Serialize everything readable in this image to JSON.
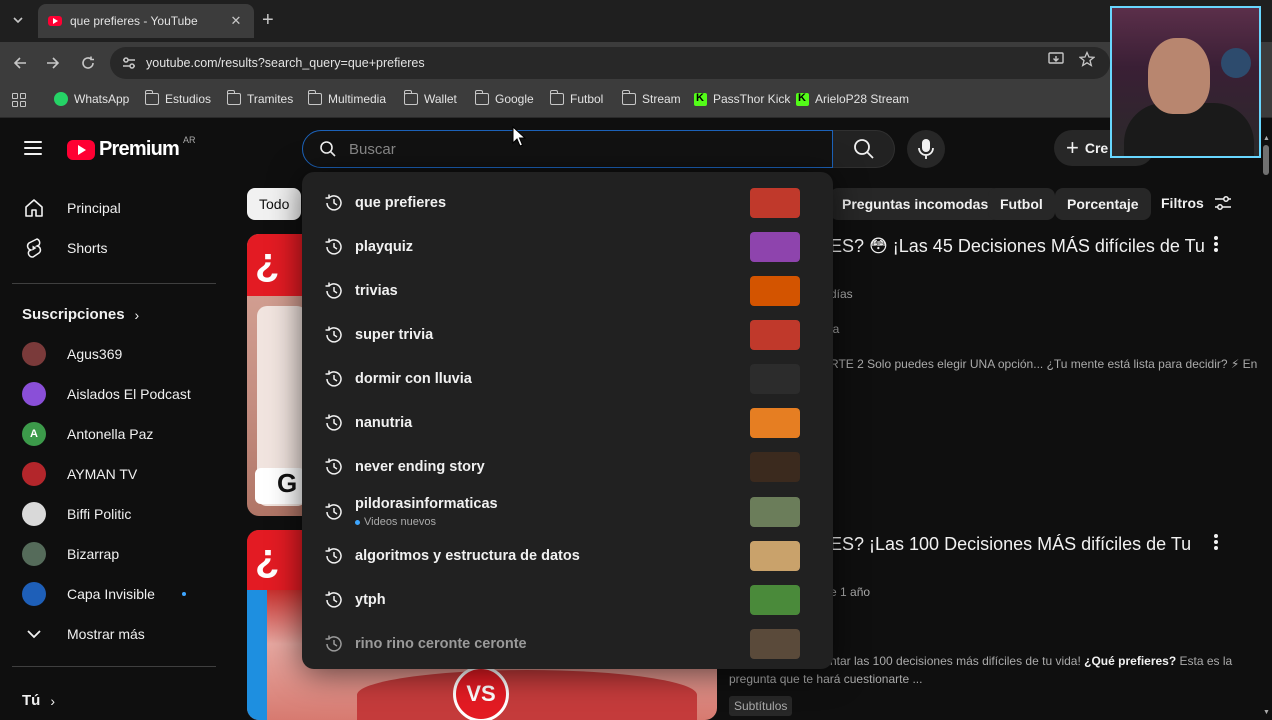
{
  "browser": {
    "tab_title": "que prefieres - YouTube",
    "url": "youtube.com/results?search_query=que+prefieres",
    "bookmarks": [
      "WhatsApp",
      "Estudios",
      "Tramites",
      "Multimedia",
      "Wallet",
      "Google",
      "Futbol",
      "Stream",
      "PassThor Kick",
      "ArieloP28 Stream"
    ]
  },
  "header": {
    "logo_text": "Premium",
    "country_code": "AR",
    "search_placeholder": "Buscar",
    "create_label": "Cre"
  },
  "sidebar": {
    "main": [
      {
        "label": "Principal",
        "icon": "home-icon"
      },
      {
        "label": "Shorts",
        "icon": "shorts-icon"
      }
    ],
    "subscriptions_heading": "Suscripciones",
    "subscriptions": [
      {
        "label": "Agus369",
        "color": "#7a3a3a",
        "initial": ""
      },
      {
        "label": "Aislados El Podcast",
        "color": "#8a4fd8",
        "initial": ""
      },
      {
        "label": "Antonella Paz",
        "color": "#3c9a4a",
        "initial": "A"
      },
      {
        "label": "AYMAN TV",
        "color": "#b3262b",
        "initial": ""
      },
      {
        "label": "Biffi Politic",
        "color": "#d9d9d9",
        "initial": ""
      },
      {
        "label": "Bizarrap",
        "color": "#556b5a",
        "initial": ""
      },
      {
        "label": "Capa Invisible",
        "color": "#1e5fb8",
        "initial": ""
      }
    ],
    "show_more": "Mostrar más",
    "you_heading": "Tú"
  },
  "chips": [
    "Todo",
    "Preguntas incomodas",
    "Futbol",
    "Porcentaje"
  ],
  "filters_label": "Filtros",
  "videos": [
    {
      "title": "ES? 😳 ¡Las 45 Decisiones MÁS difíciles de Tu",
      "meta": "días",
      "channel_frag": "ia",
      "desc": "RTE 2 Solo puedes elegir UNA opción... ¿Tu mente está lista para decidir? ⚡ En"
    },
    {
      "title": "ES? ¡Las 100 Decisiones MÁS difíciles de Tu",
      "meta": "e 1 año",
      "desc1_a": "ntar las 100 decisiones más difíciles de tu vida! ",
      "desc1_b": "¿Qué prefieres?",
      "desc1_c": " Esta es la",
      "desc2": "pregunta que te hará cuestionarte ...",
      "badge": "Subtítulos"
    }
  ],
  "suggestions": [
    {
      "text": "que prefieres",
      "thumb": "#c0392b"
    },
    {
      "text": "playquiz",
      "thumb": "#8e44ad"
    },
    {
      "text": "trivias",
      "thumb": "#d35400"
    },
    {
      "text": "super trivia",
      "thumb": "#c0392b"
    },
    {
      "text": "dormir con lluvia",
      "thumb": "#2c2c2c"
    },
    {
      "text": "nanutria",
      "thumb": "#e67e22"
    },
    {
      "text": "never ending story",
      "thumb": "#3b2a1e"
    },
    {
      "text": "pildorasinformaticas",
      "sub": "Videos nuevos",
      "thumb": "#6b7d5a"
    },
    {
      "text": "algoritmos y estructura de datos",
      "thumb": "#c9a26b"
    },
    {
      "text": "ytph",
      "thumb": "#4a8a3a"
    },
    {
      "text": "rino rino ceronte ceronte",
      "thumb": "#5a4a3a"
    }
  ]
}
